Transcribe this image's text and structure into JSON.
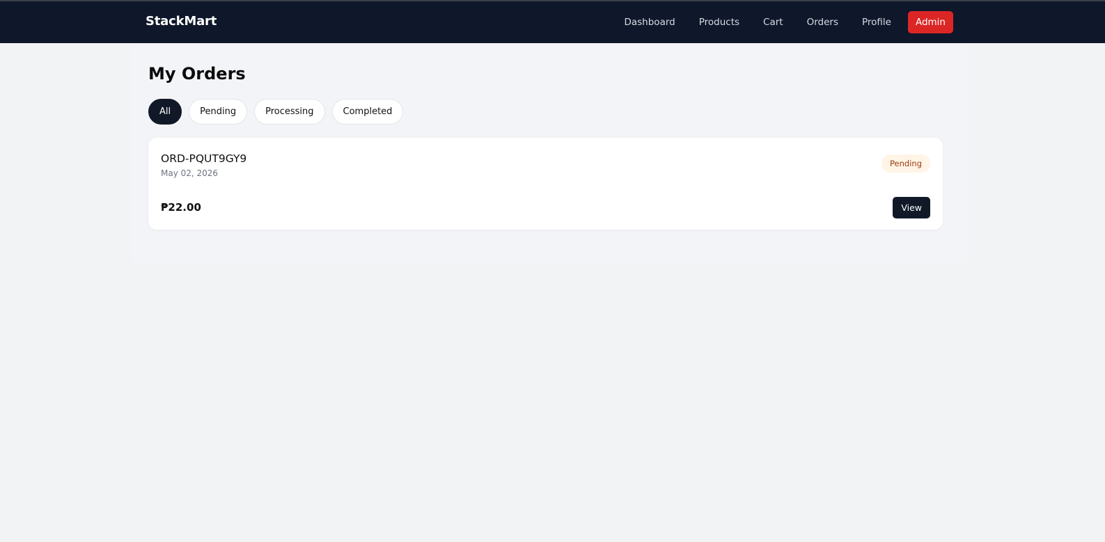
{
  "navbar": {
    "brand": "StackMart",
    "links": [
      "Dashboard",
      "Products",
      "Cart",
      "Orders",
      "Profile"
    ],
    "admin_label": "Admin"
  },
  "page": {
    "title": "My Orders"
  },
  "filters": {
    "items": [
      "All",
      "Pending",
      "Processing",
      "Completed"
    ],
    "active": "All"
  },
  "orders": [
    {
      "id": "ORD-PQUT9GY9",
      "date": "May 02, 2026",
      "status": "Pending",
      "total": "₱22.00",
      "view_label": "View"
    }
  ],
  "colors": {
    "navbar_bg": "#0f172a",
    "admin_button": "#dc2626",
    "active_chip": "#111827",
    "pending_badge_bg": "#fff4e6",
    "pending_badge_text": "#9a3c0f"
  }
}
